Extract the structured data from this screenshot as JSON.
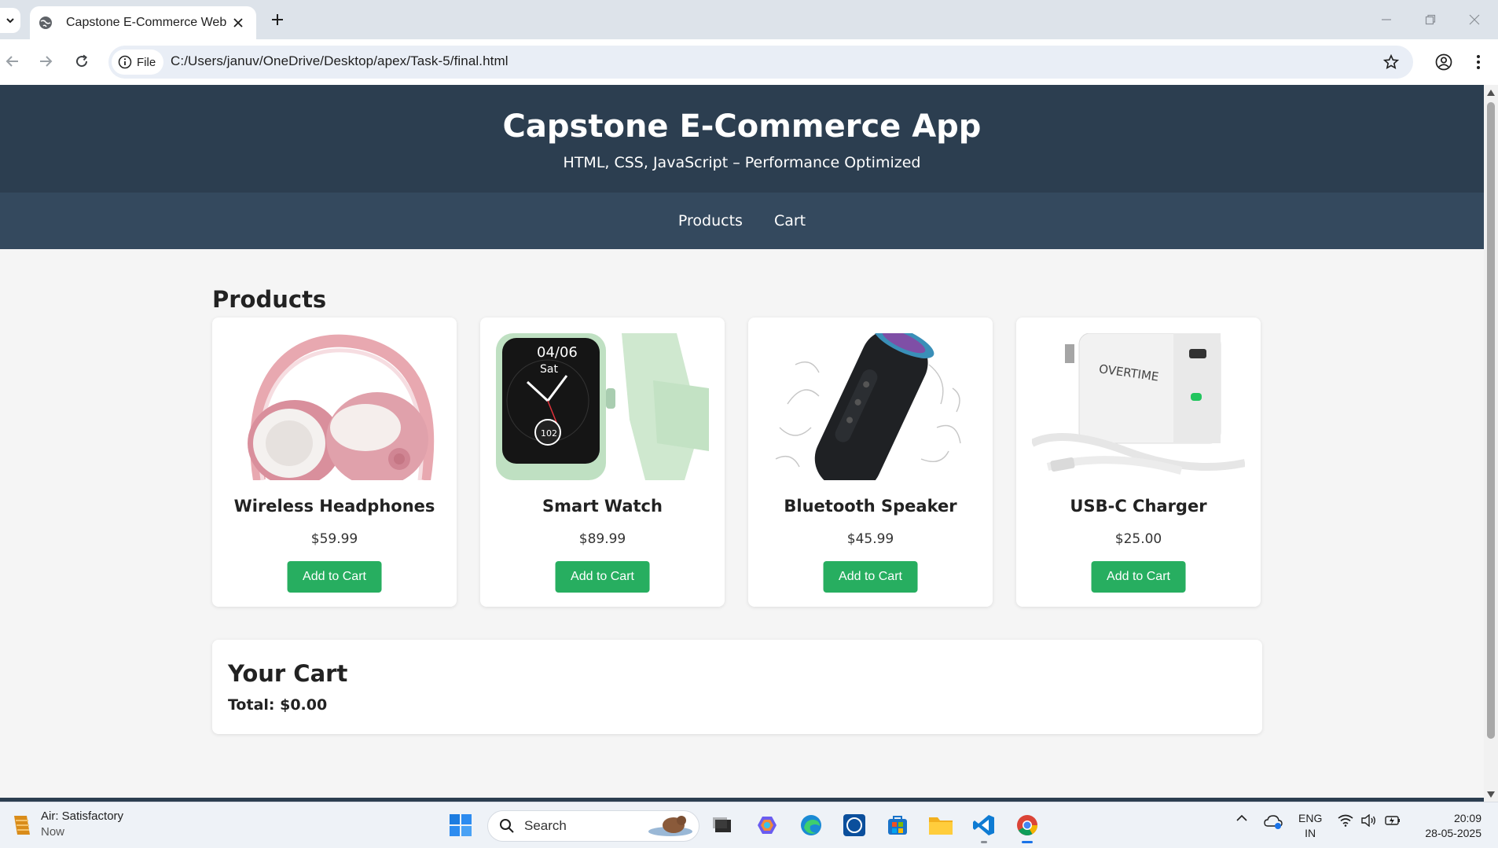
{
  "browser": {
    "tab_title": "Capstone E-Commerce Web Ap",
    "site_chip_label": "File",
    "url": "C:/Users/januv/OneDrive/Desktop/apex/Task-5/final.html"
  },
  "site": {
    "title": "Capstone E-Commerce App",
    "subtitle": "HTML, CSS, JavaScript – Performance Optimized",
    "nav": [
      "Products",
      "Cart"
    ]
  },
  "products_section": {
    "title": "Products",
    "items": [
      {
        "name": "Wireless Headphones",
        "price": "$59.99",
        "button": "Add to Cart",
        "image": "pink-headphones-image"
      },
      {
        "name": "Smart Watch",
        "price": "$89.99",
        "button": "Add to Cart",
        "image": "green-smartwatch-image"
      },
      {
        "name": "Bluetooth Speaker",
        "price": "$45.99",
        "button": "Add to Cart",
        "image": "black-speaker-image"
      },
      {
        "name": "USB-C Charger",
        "price": "$25.00",
        "button": "Add to Cart",
        "image": "white-charger-image"
      }
    ]
  },
  "cart": {
    "title": "Your Cart",
    "total": "Total: $0.00"
  },
  "taskbar": {
    "weather_title": "Air: Satisfactory",
    "weather_sub": "Now",
    "search_label": "Search",
    "lang_line1": "ENG",
    "lang_line2": "IN",
    "time": "20:09",
    "date": "28-05-2025"
  },
  "colors": {
    "header_bg": "#2c3e50",
    "nav_bg": "#34495e",
    "button_green": "#27ae60",
    "page_bg": "#f5f5f5"
  }
}
